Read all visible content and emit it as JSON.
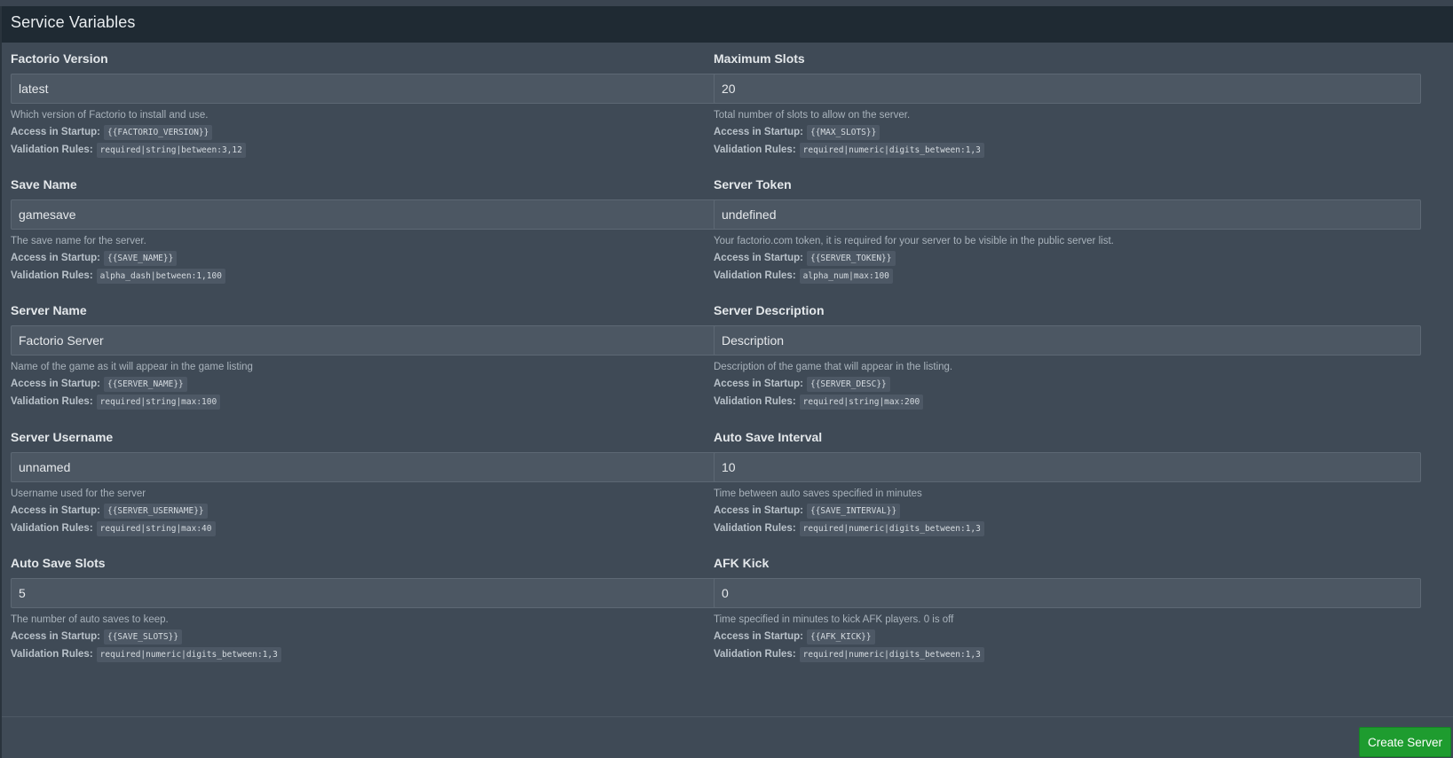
{
  "panel": {
    "title": "Service Variables"
  },
  "labels": {
    "access": "Access in Startup:",
    "rules": "Validation Rules:"
  },
  "variables": [
    {
      "name": "Factorio Version",
      "value": "latest",
      "description": "Which version of Factorio to install and use.",
      "env": "{{FACTORIO_VERSION}}",
      "rules": "required|string|between:3,12"
    },
    {
      "name": "Maximum Slots",
      "value": "20",
      "description": "Total number of slots to allow on the server.",
      "env": "{{MAX_SLOTS}}",
      "rules": "required|numeric|digits_between:1,3"
    },
    {
      "name": "Save Name",
      "value": "gamesave",
      "description": "The save name for the server.",
      "env": "{{SAVE_NAME}}",
      "rules": "alpha_dash|between:1,100"
    },
    {
      "name": "Server Token",
      "value": "undefined",
      "description": "Your factorio.com token, it is required for your server to be visible in the public server list.",
      "env": "{{SERVER_TOKEN}}",
      "rules": "alpha_num|max:100"
    },
    {
      "name": "Server Name",
      "value": "Factorio Server",
      "description": "Name of the game as it will appear in the game listing",
      "env": "{{SERVER_NAME}}",
      "rules": "required|string|max:100"
    },
    {
      "name": "Server Description",
      "value": "Description",
      "description": "Description of the game that will appear in the listing.",
      "env": "{{SERVER_DESC}}",
      "rules": "required|string|max:200"
    },
    {
      "name": "Server Username",
      "value": "unnamed",
      "description": "Username used for the server",
      "env": "{{SERVER_USERNAME}}",
      "rules": "required|string|max:40"
    },
    {
      "name": "Auto Save Interval",
      "value": "10",
      "description": "Time between auto saves specified in minutes",
      "env": "{{SAVE_INTERVAL}}",
      "rules": "required|numeric|digits_between:1,3"
    },
    {
      "name": "Auto Save Slots",
      "value": "5",
      "description": "The number of auto saves to keep.",
      "env": "{{SAVE_SLOTS}}",
      "rules": "required|numeric|digits_between:1,3"
    },
    {
      "name": "AFK Kick",
      "value": "0",
      "description": "Time specified in minutes to kick AFK players. 0 is off",
      "env": "{{AFK_KICK}}",
      "rules": "required|numeric|digits_between:1,3"
    }
  ],
  "footer": {
    "create_label": "Create Server"
  },
  "colors": {
    "background": "#3f4a56",
    "header": "#1f2a33",
    "input": "#4c5763",
    "accent_button": "#1e9c2f"
  }
}
